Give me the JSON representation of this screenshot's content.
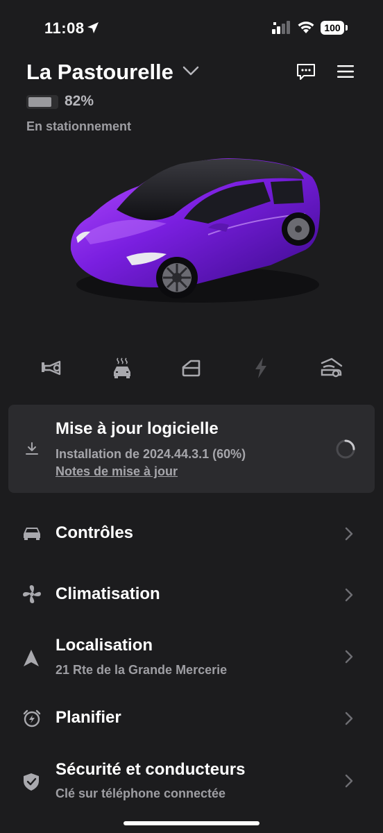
{
  "status_bar": {
    "time": "11:08",
    "battery": "100"
  },
  "header": {
    "vehicle_name": "La Pastourelle",
    "battery_percent": "82%",
    "battery_level": 0.82,
    "status": "En stationnement"
  },
  "quick_controls": [
    "horn-icon",
    "climate-icon",
    "frunk-icon",
    "charge-icon",
    "trunk-icon"
  ],
  "update": {
    "title": "Mise à jour logicielle",
    "subtitle": "Installation de 2024.44.3.1 (60%)",
    "notes_link": "Notes de mise à jour",
    "progress": 0.6
  },
  "menu": {
    "controls": {
      "title": "Contrôles"
    },
    "climate": {
      "title": "Climatisation"
    },
    "location": {
      "title": "Localisation",
      "subtitle": "21 Rte de la Grande Mercerie"
    },
    "schedule": {
      "title": "Planifier"
    },
    "security": {
      "title": "Sécurité et conducteurs",
      "subtitle": "Clé sur téléphone connectée"
    }
  },
  "colors": {
    "background": "#1c1c1e",
    "card": "#2b2b2e",
    "car_paint": "#7a1fe0"
  }
}
